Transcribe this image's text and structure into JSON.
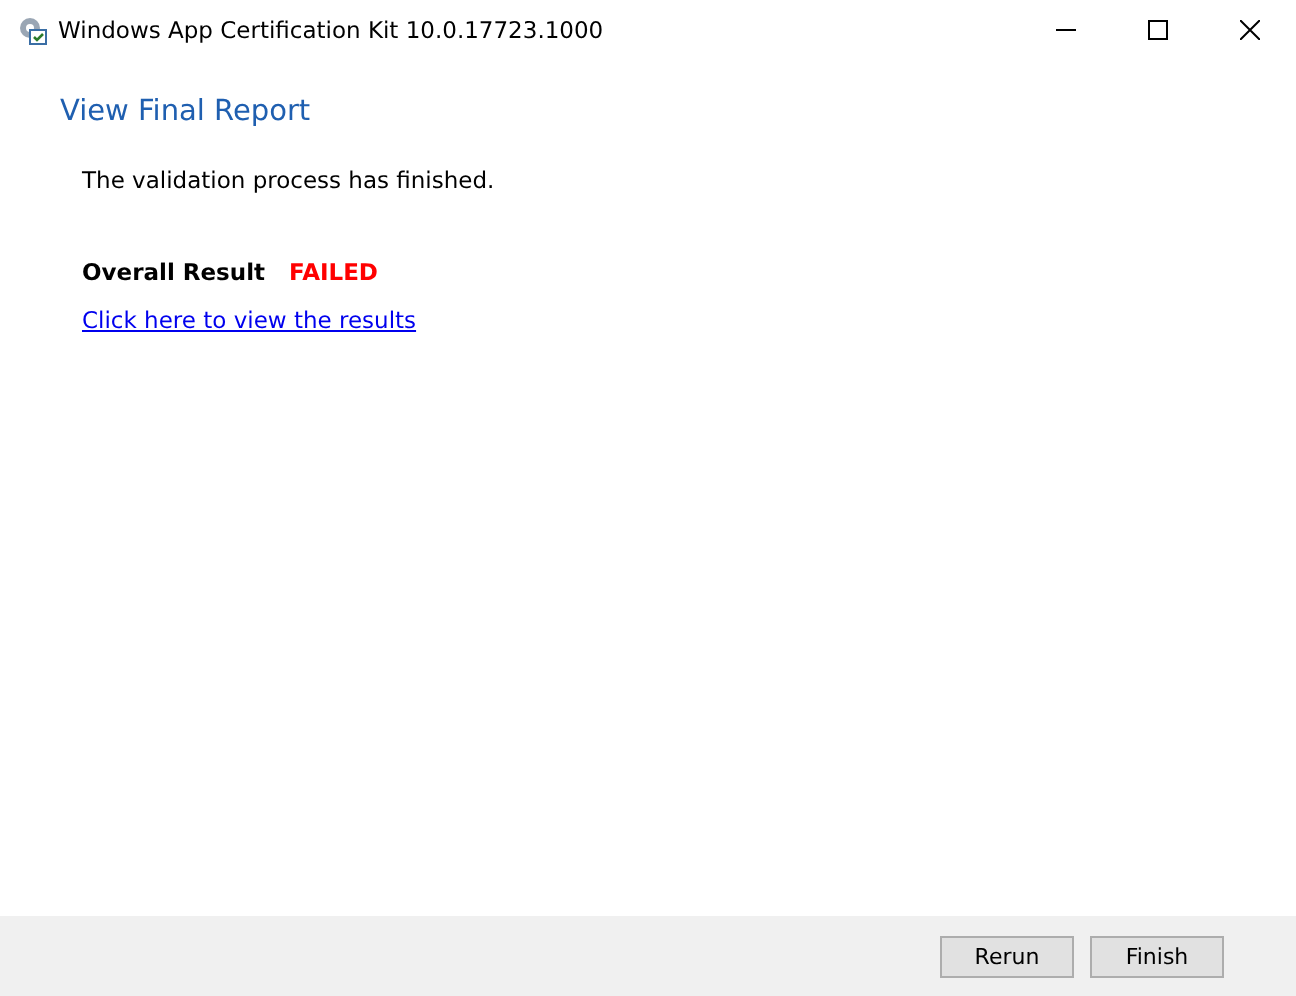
{
  "window": {
    "title": "Windows App Certification Kit 10.0.17723.1000"
  },
  "heading": "View Final Report",
  "message": "The validation process has finished.",
  "result": {
    "label": "Overall Result",
    "value": "FAILED",
    "passed": false
  },
  "link": "Click here to view the results",
  "buttons": [
    "Rerun",
    "Finish"
  ]
}
